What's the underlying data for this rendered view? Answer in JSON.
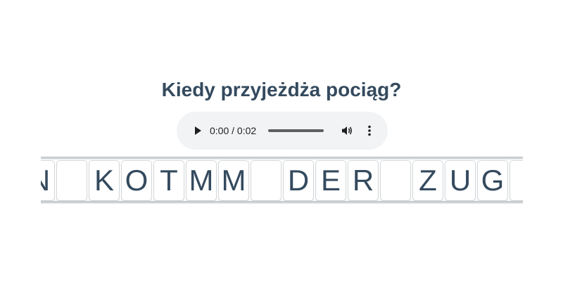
{
  "question": "Kiedy przyjeżdża pociąg?",
  "audio": {
    "time_display": "0:00 / 0:02",
    "progress": 0
  },
  "letters": [
    "N",
    "",
    "K",
    "O",
    "T",
    "M",
    "M",
    "",
    "D",
    "E",
    "R",
    "",
    "Z",
    "U",
    "G",
    ""
  ],
  "colors": {
    "text": "#344a5e",
    "player_bg": "#f1f3f4",
    "rail": "#cfd3d6"
  }
}
